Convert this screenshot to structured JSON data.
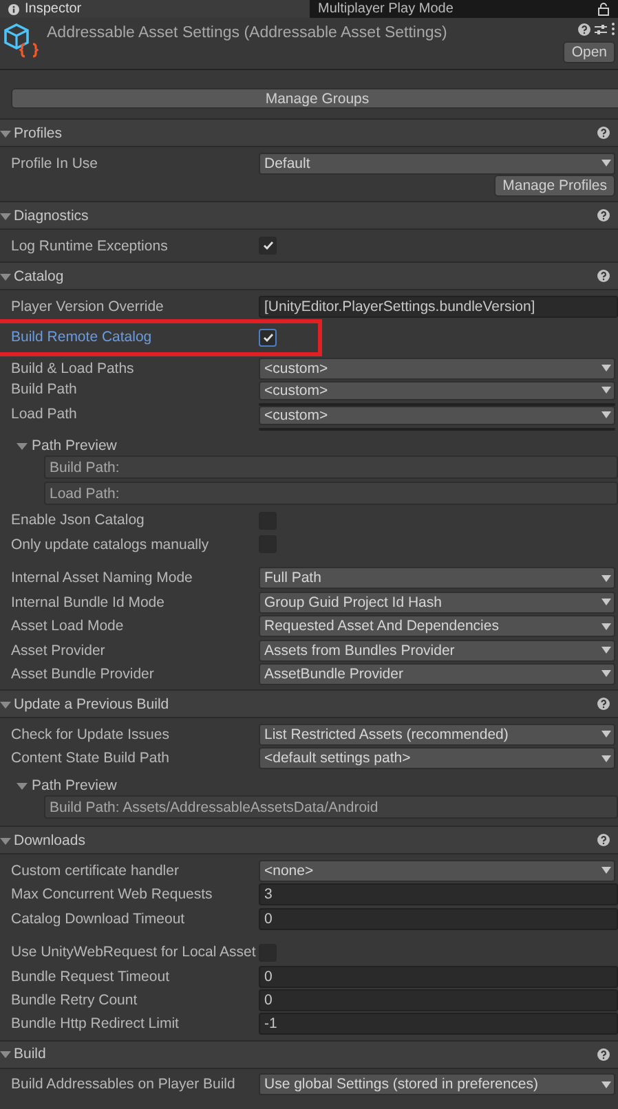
{
  "tabs": [
    {
      "label": "Inspector",
      "selected": true
    },
    {
      "label": "Multiplayer Play Mode",
      "selected": false
    }
  ],
  "header": {
    "title": "Addressable Asset Settings (Addressable Asset Settings)",
    "open_button": "Open"
  },
  "manage_groups_button": "Manage Groups",
  "sections": [
    {
      "title": "Profiles",
      "expanded": true,
      "rows": [
        {
          "kind": "dropdown",
          "label": "Profile In Use",
          "value": "Default",
          "modified": false,
          "marked": false
        },
        {
          "kind": "button",
          "label": "Manage Profiles"
        }
      ]
    },
    {
      "title": "Diagnostics",
      "expanded": true,
      "rows": [
        {
          "kind": "checkbox",
          "label": "Log Runtime Exceptions",
          "checked": true,
          "modified": false,
          "marked": false
        }
      ]
    },
    {
      "title": "Catalog",
      "expanded": true,
      "rows": [
        {
          "kind": "field",
          "label": "Player Version Override",
          "value": "[UnityEditor.PlayerSettings.bundleVersion]",
          "modified": false,
          "marked": false
        },
        {
          "kind": "checkbox",
          "label": "Build Remote Catalog",
          "checked": true,
          "modified": true,
          "marked": true
        },
        {
          "kind": "dropdown",
          "label": "Build & Load Paths",
          "value": "<custom>",
          "modified": false,
          "marked": false
        },
        {
          "kind": "path",
          "label": "Build Path",
          "value": "<custom>",
          "modified": false,
          "marked": false
        },
        {
          "kind": "path",
          "label": "Load Path",
          "value": "<custom>",
          "modified": false,
          "marked": false
        },
        {
          "kind": "preview",
          "title": "Path Preview",
          "expanded": true,
          "lines": [
            "Build Path:",
            "Load Path:"
          ]
        },
        {
          "kind": "checkbox",
          "label": "Enable Json Catalog",
          "checked": false,
          "modified": false,
          "marked": false
        },
        {
          "kind": "checkbox",
          "label": "Only update catalogs manually",
          "checked": false,
          "modified": false,
          "marked": false
        },
        {
          "kind": "gap"
        },
        {
          "kind": "dropdown",
          "label": "Internal Asset Naming Mode",
          "value": "Full Path",
          "modified": false,
          "marked": false
        },
        {
          "kind": "dropdown",
          "label": "Internal Bundle Id Mode",
          "value": "Group Guid Project Id Hash",
          "modified": false,
          "marked": false
        },
        {
          "kind": "dropdown",
          "label": "Asset Load Mode",
          "value": "Requested Asset And Dependencies",
          "modified": false,
          "marked": false
        },
        {
          "kind": "dropdown",
          "label": "Asset Provider",
          "value": "Assets from Bundles Provider",
          "modified": false,
          "marked": false
        },
        {
          "kind": "dropdown",
          "label": "Asset Bundle Provider",
          "value": "AssetBundle Provider",
          "modified": false,
          "marked": false
        }
      ]
    },
    {
      "title": "Update a Previous Build",
      "expanded": true,
      "rows": [
        {
          "kind": "dropdown",
          "label": "Check for Update Issues",
          "value": "List Restricted Assets (recommended)",
          "modified": false,
          "marked": false
        },
        {
          "kind": "dropdown",
          "label": "Content State Build Path",
          "value": "<default settings path>",
          "modified": false,
          "marked": false
        },
        {
          "kind": "preview",
          "title": "Path Preview",
          "expanded": true,
          "lines": [
            "Build Path: Assets/AddressableAssetsData/Android"
          ]
        }
      ]
    },
    {
      "title": "Downloads",
      "expanded": true,
      "rows": [
        {
          "kind": "dropdown",
          "label": "Custom certificate handler",
          "value": "<none>",
          "modified": false,
          "marked": false
        },
        {
          "kind": "field",
          "label": "Max Concurrent Web Requests",
          "value": "3",
          "modified": false,
          "marked": false
        },
        {
          "kind": "field",
          "label": "Catalog Download Timeout",
          "value": "0",
          "modified": false,
          "marked": false
        },
        {
          "kind": "gap"
        },
        {
          "kind": "checkbox",
          "label": "Use UnityWebRequest for Local Asset",
          "checked": false,
          "modified": false,
          "marked": false
        },
        {
          "kind": "field",
          "label": "Bundle Request Timeout",
          "value": "0",
          "modified": false,
          "marked": false
        },
        {
          "kind": "field",
          "label": "Bundle Retry Count",
          "value": "0",
          "modified": false,
          "marked": false
        },
        {
          "kind": "field",
          "label": "Bundle Http Redirect Limit",
          "value": "-1",
          "modified": false,
          "marked": false
        }
      ]
    },
    {
      "title": "Build",
      "expanded": true,
      "rows": [
        {
          "kind": "dropdown",
          "label": "Build Addressables on Player Build",
          "value": "Use global Settings (stored in preferences)",
          "modified": false,
          "marked": false
        }
      ]
    }
  ]
}
